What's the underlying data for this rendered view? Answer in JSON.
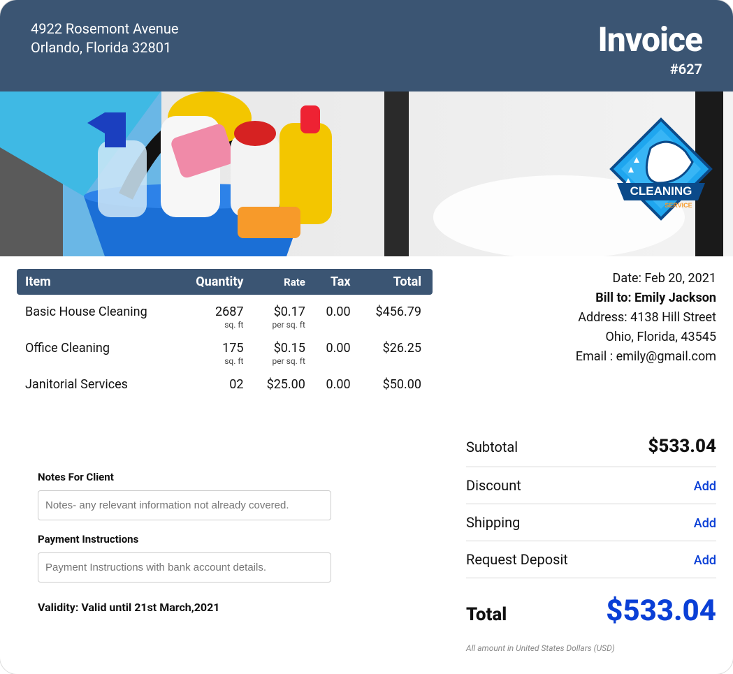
{
  "header": {
    "address_line1": "4922 Rosemont Avenue",
    "address_line2": "Orlando, Florida 32801",
    "title": "Invoice",
    "number": "#627"
  },
  "logo": {
    "text_main": "CLEANING",
    "text_sub": "SERVICE"
  },
  "table": {
    "headers": {
      "item": "Item",
      "qty": "Quantity",
      "rate": "Rate",
      "tax": "Tax",
      "total": "Total"
    },
    "rows": [
      {
        "item": "Basic House Cleaning",
        "qty": "2687",
        "qty_unit": "sq. ft",
        "rate": "$0.17",
        "rate_unit": "per sq. ft",
        "tax": "0.00",
        "total": "$456.79"
      },
      {
        "item": "Office Cleaning",
        "qty": "175",
        "qty_unit": "sq. ft",
        "rate": "$0.15",
        "rate_unit": "per sq. ft",
        "tax": "0.00",
        "total": "$26.25"
      },
      {
        "item": "Janitorial Services",
        "qty": "02",
        "qty_unit": "",
        "rate": "$25.00",
        "rate_unit": "",
        "tax": "0.00",
        "total": "$50.00"
      }
    ]
  },
  "billto": {
    "date_label": "Date: ",
    "date": "Feb 20, 2021",
    "bill_label": "Bill to: ",
    "name": "Emily Jackson",
    "address_label": "Address: ",
    "address1": "4138 Hill Street",
    "address2": "Ohio, Florida, 43545",
    "email_label": "Email : ",
    "email": "emily@gmail.com"
  },
  "notes": {
    "heading1": "Notes For Client",
    "placeholder1": "Notes- any relevant information not already covered.",
    "heading2": "Payment Instructions",
    "placeholder2": "Payment Instructions with bank account details.",
    "validity": "Validity: Valid until 21st March,2021"
  },
  "summary": {
    "subtotal_label": "Subtotal",
    "subtotal": "$533.04",
    "discount_label": "Discount",
    "shipping_label": "Shipping",
    "deposit_label": "Request Deposit",
    "add": "Add",
    "total_label": "Total",
    "total": "$533.04",
    "currency_note": "All amount in United States Dollars (USD)"
  }
}
